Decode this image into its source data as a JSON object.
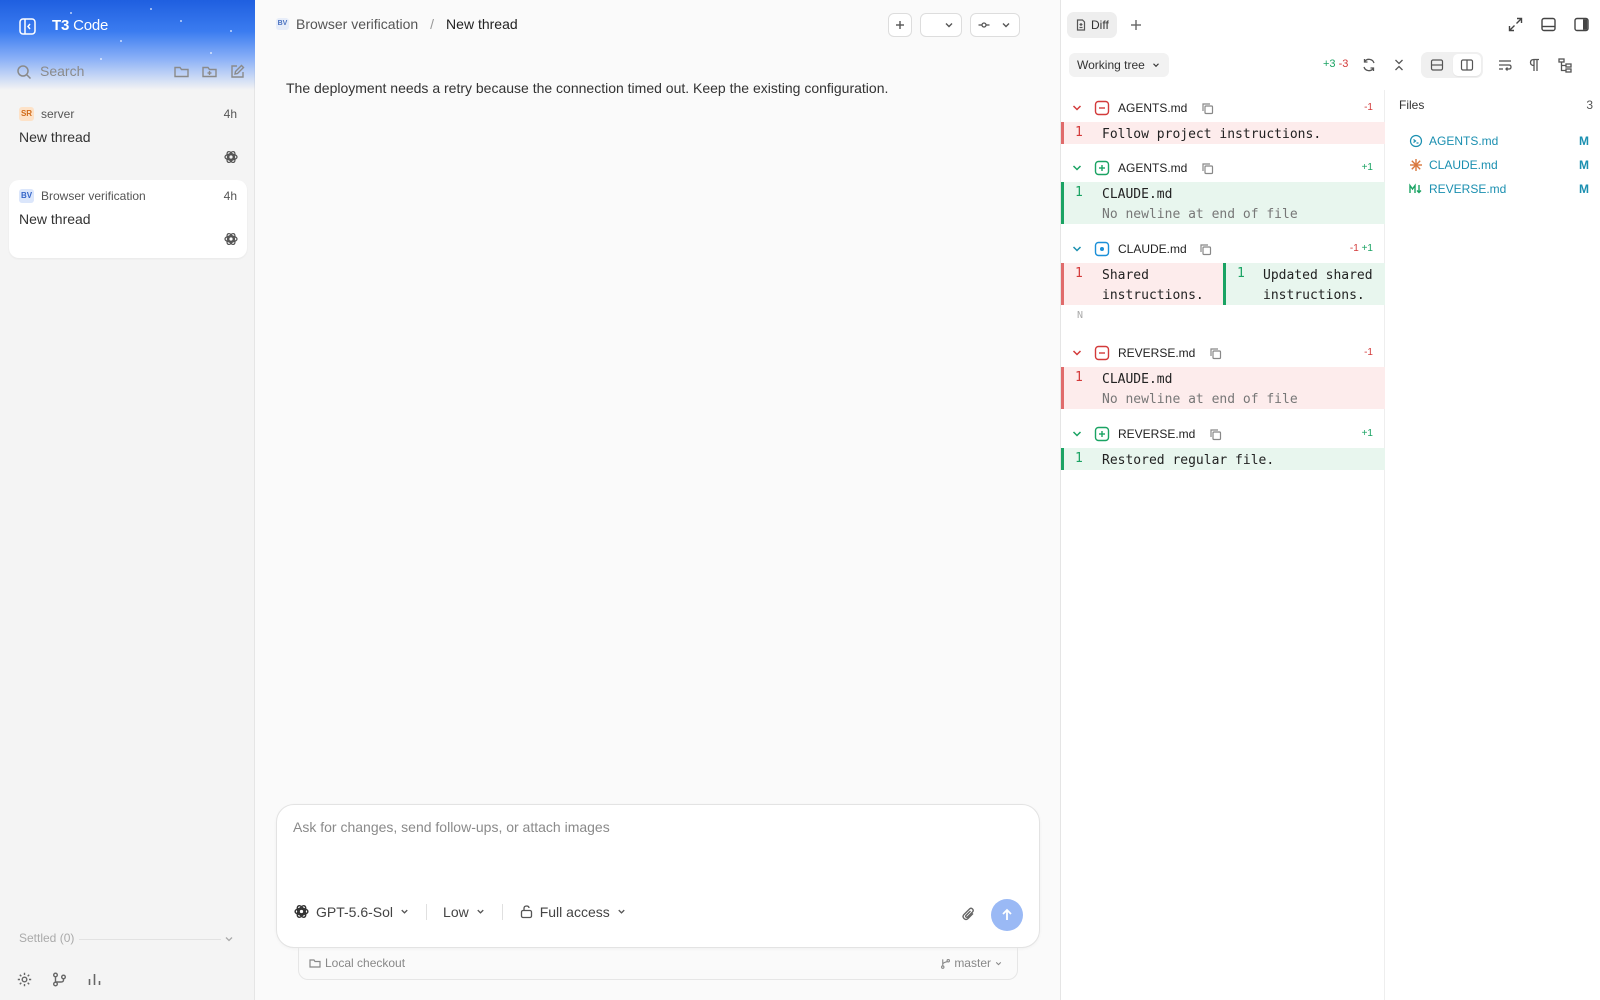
{
  "sidebar": {
    "brand_bold": "T3",
    "brand_rest": " Code",
    "search_label": "Search",
    "threads": [
      {
        "badge": "SR",
        "project": "server",
        "time": "4h",
        "title": "New thread"
      },
      {
        "badge": "BV",
        "project": "Browser verification",
        "time": "4h",
        "title": "New thread"
      }
    ],
    "settled_label": "Settled (0)"
  },
  "header": {
    "badge": "BV",
    "project": "Browser verification",
    "separator": "/",
    "title": "New thread"
  },
  "message": "The deployment needs a retry because the connection timed out. Keep the existing configuration.",
  "composer": {
    "placeholder": "Ask for changes, send follow-ups, or attach images",
    "model": "GPT-5.6-Sol",
    "effort": "Low",
    "access": "Full access"
  },
  "status": {
    "checkout": "Local checkout",
    "branch": "master"
  },
  "diff": {
    "tab_label": "Diff",
    "working_tree": "Working tree",
    "total_add": "+3",
    "total_del": "-3",
    "files_header": "Files",
    "files_count": "3",
    "sections": [
      {
        "file": "AGENTS.md",
        "status": "deleted",
        "count": "-1"
      },
      {
        "file": "AGENTS.md",
        "status": "added",
        "count": "+1"
      },
      {
        "file": "CLAUDE.md",
        "status": "modified",
        "count_del": "-1",
        "count_add": "+1"
      },
      {
        "file": "REVERSE.md",
        "status": "deleted",
        "count": "-1"
      },
      {
        "file": "REVERSE.md",
        "status": "added",
        "count": "+1"
      }
    ],
    "lines": {
      "l1": {
        "num": "1",
        "text": "Follow project instructions."
      },
      "l2": {
        "num": "1",
        "text": "CLAUDE.md",
        "note": "No newline at end of file"
      },
      "l3_old": {
        "num": "1",
        "text": "Shared\ninstructions."
      },
      "l3_new": {
        "num": "1",
        "text": "Updated shared\ninstructions."
      },
      "l3_more": "N",
      "l4": {
        "num": "1",
        "text": "CLAUDE.md",
        "note": "No newline at end of file"
      },
      "l5": {
        "num": "1",
        "text": "Restored regular file."
      }
    },
    "file_list": [
      {
        "name": "AGENTS.md",
        "mark": "M"
      },
      {
        "name": "CLAUDE.md",
        "mark": "M"
      },
      {
        "name": "REVERSE.md",
        "mark": "M"
      }
    ]
  },
  "colors": {
    "accent": "#2563eb",
    "add": "#1aa363",
    "del": "#d33a3a",
    "file_link": "#1a8fb0"
  }
}
